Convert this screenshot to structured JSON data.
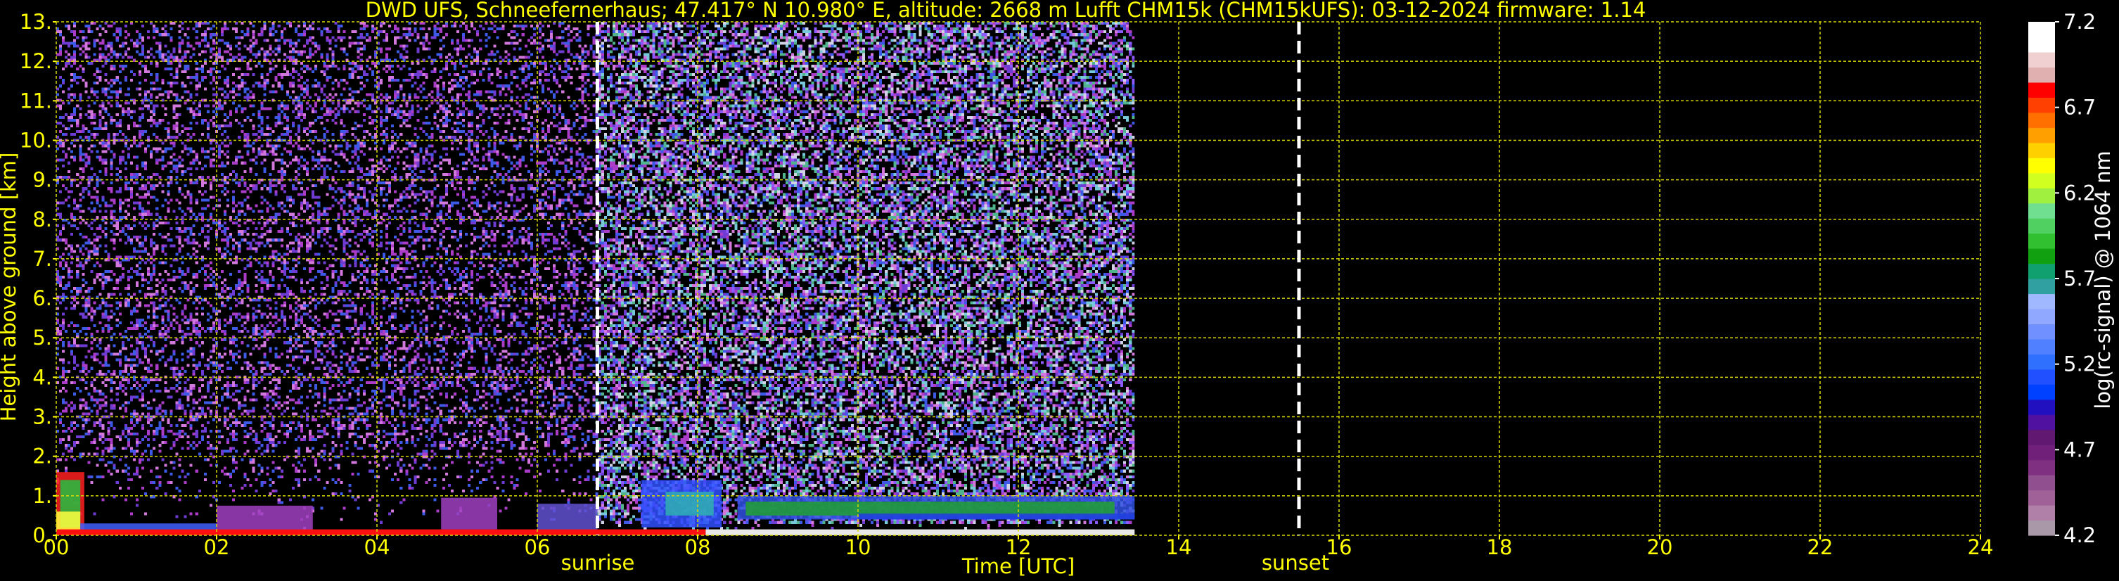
{
  "title": "DWD UFS, Schneefernerhaus; 47.417° N 10.980° E, altitude: 2668 m    Lufft CHM15k (CHM15kUFS): 03-12-2024    firmware: 1.14",
  "chart_data": {
    "type": "heatmap",
    "title": "DWD UFS, Schneefernerhaus; 47.417° N 10.980° E, altitude: 2668 m    Lufft CHM15k (CHM15kUFS): 03-12-2024    firmware: 1.14",
    "xlabel": "Time [UTC]",
    "ylabel": "Height above ground [km]",
    "xlim": [
      0,
      24
    ],
    "ylim": [
      0,
      13
    ],
    "x_ticks": [
      "00",
      "02",
      "04",
      "06",
      "08",
      "10",
      "12",
      "14",
      "16",
      "18",
      "20",
      "22",
      "24"
    ],
    "y_ticks": [
      "0.",
      "1.",
      "2.",
      "3.",
      "4.",
      "5.",
      "6.",
      "7.",
      "8.",
      "9.",
      "10.",
      "11.",
      "12.",
      "13."
    ],
    "grid": true,
    "data_end_hour": 13.45,
    "sunrise_hour": 6.75,
    "sunset_hour": 15.5,
    "sunrise_label": "sunrise",
    "sunset_label": "sunset",
    "colorbar": {
      "label": "log(rc-signal) @ 1064 nm",
      "range": [
        4.2,
        7.2
      ],
      "ticks": [
        "7.2",
        "6.7",
        "6.2",
        "5.7",
        "5.2",
        "4.7",
        "4.2"
      ],
      "colors": [
        "#a898a8",
        "#b080a8",
        "#a06098",
        "#905090",
        "#803080",
        "#702078",
        "#601870",
        "#5010a0",
        "#2010c0",
        "#0040ff",
        "#2050ff",
        "#3070ff",
        "#5080ff",
        "#7090ff",
        "#90a8ff",
        "#a0b8ff",
        "#30a0a0",
        "#10a070",
        "#10a010",
        "#30c030",
        "#50d060",
        "#70e090",
        "#a0f040",
        "#d0ff20",
        "#ffff00",
        "#ffd000",
        "#ffa000",
        "#ff7000",
        "#ff4000",
        "#ff0000",
        "#e0b0b0",
        "#f0d0d0",
        "#ffffff",
        "#ffffff"
      ]
    },
    "layers": [
      {
        "name": "noise",
        "x_range": [
          0,
          13.45
        ],
        "y_range": [
          0.2,
          13
        ]
      },
      {
        "name": "boundary layer",
        "x_range": [
          0,
          13.45
        ],
        "y_range": [
          0,
          1.7
        ]
      }
    ]
  }
}
